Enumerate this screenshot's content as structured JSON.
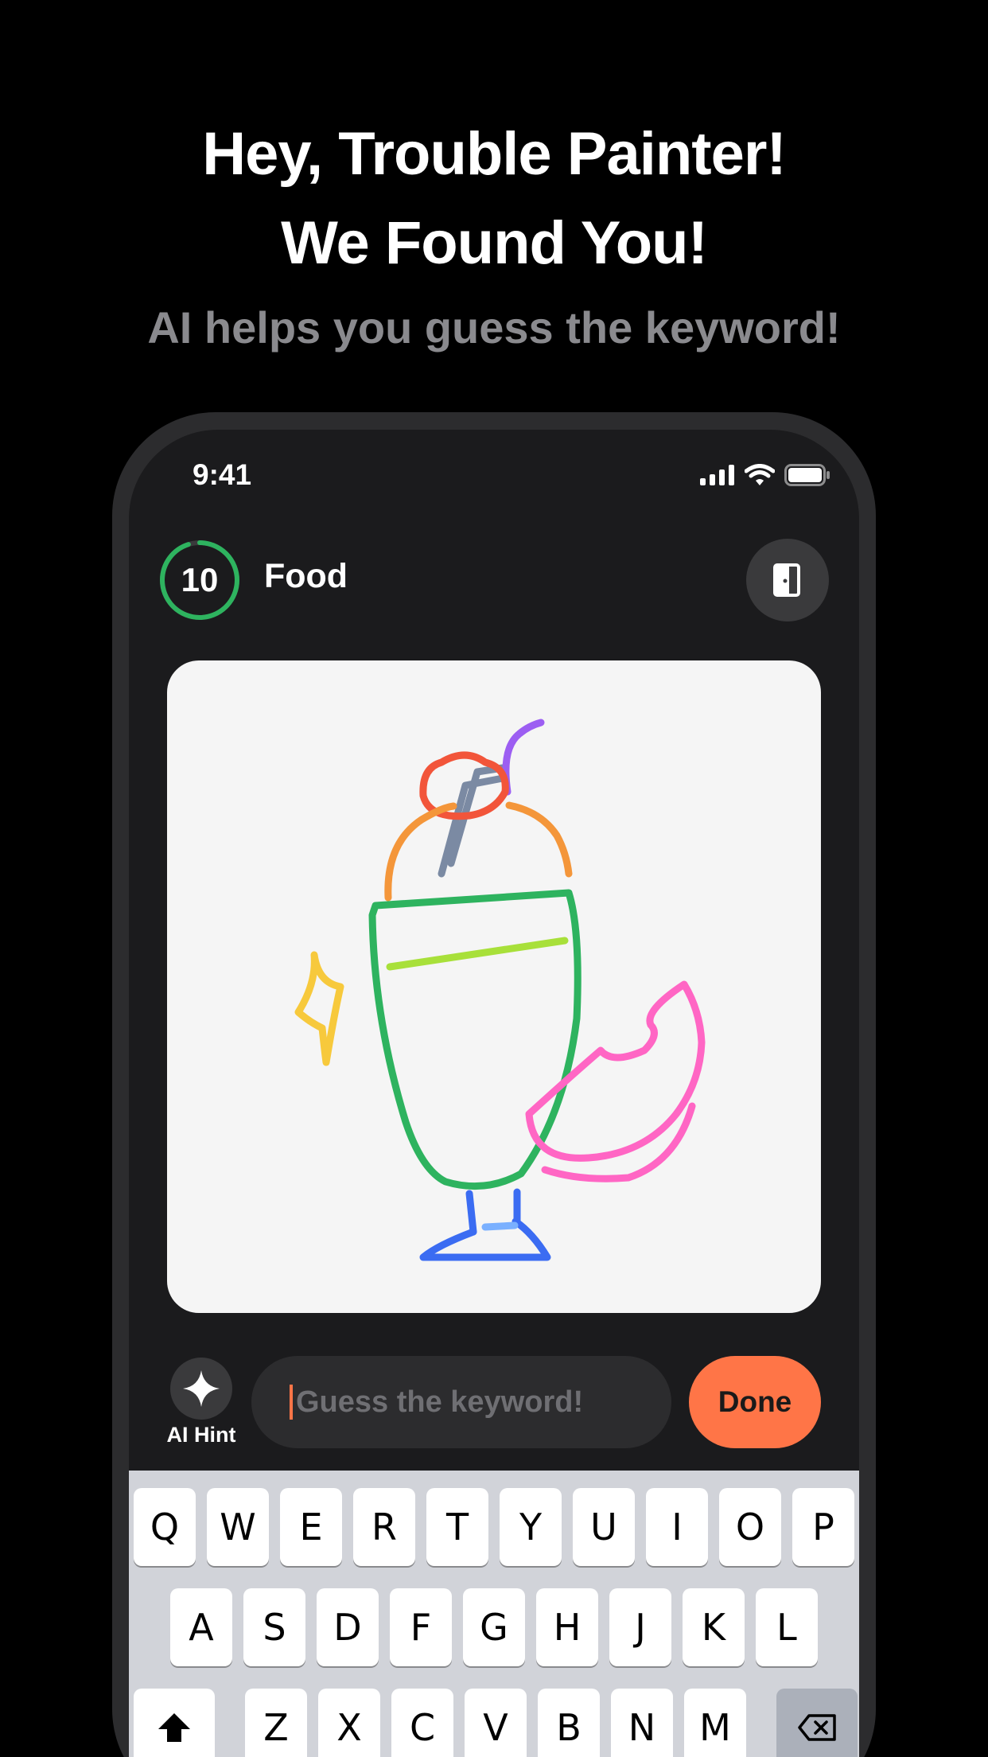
{
  "promo": {
    "headline_line1": "Hey, Trouble Painter!",
    "headline_line2": "We Found You!",
    "subheadline": "AI helps you guess the keyword!"
  },
  "status_bar": {
    "time": "9:41",
    "icons": [
      "signal-icon",
      "wifi-icon",
      "battery-icon"
    ]
  },
  "game_header": {
    "timer_value": "10",
    "timer_progress": 0.95,
    "category": "Food",
    "exit_icon": "door-exit-icon"
  },
  "drawing": {
    "subject": "milkshake doodle"
  },
  "input_bar": {
    "hint_label": "AI Hint",
    "hint_icon": "sparkle-icon",
    "guess_placeholder": "Guess the keyword!",
    "done_label": "Done"
  },
  "keyboard": {
    "row1": [
      "Q",
      "W",
      "E",
      "R",
      "T",
      "Y",
      "U",
      "I",
      "O",
      "P"
    ],
    "row2": [
      "A",
      "S",
      "D",
      "F",
      "G",
      "H",
      "J",
      "K",
      "L"
    ],
    "row3": [
      "Z",
      "X",
      "C",
      "V",
      "B",
      "N",
      "M"
    ],
    "shift_icon": "shift-icon",
    "delete_icon": "backspace-icon"
  },
  "colors": {
    "accent": "#ff7547",
    "timer": "#2eb35f",
    "background": "#000000",
    "screen": "#1b1b1d"
  }
}
